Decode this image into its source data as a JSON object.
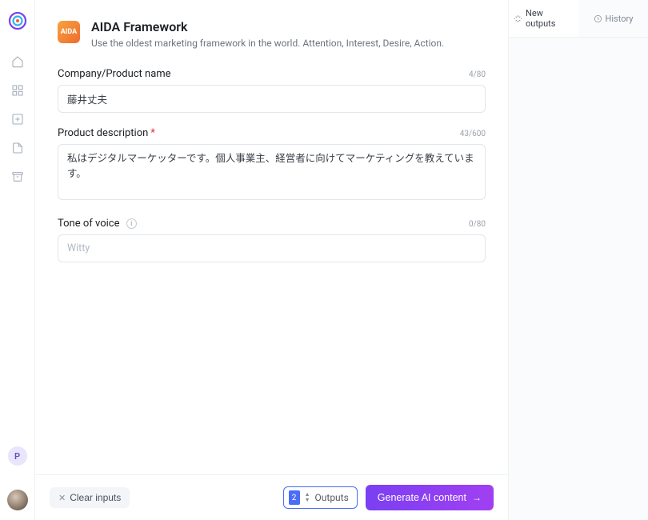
{
  "sidebar": {
    "avatar_initial": "P"
  },
  "header": {
    "icon_text": "AIDA",
    "title": "AIDA Framework",
    "subtitle": "Use the oldest marketing framework in the world. Attention, Interest, Desire, Action."
  },
  "fields": {
    "company": {
      "label": "Company/Product name",
      "value": "藤井丈夫",
      "count": "4/80"
    },
    "description": {
      "label": "Product description",
      "value": "私はデジタルマーケッターです。個人事業主、経営者に向けてマーケティングを教えています。",
      "count": "43/600"
    },
    "tone": {
      "label": "Tone of voice",
      "placeholder": "Witty",
      "value": "",
      "count": "0/80"
    }
  },
  "footer": {
    "clear_label": "Clear inputs",
    "outputs_value": "2",
    "outputs_label": "Outputs",
    "generate_label": "Generate AI content"
  },
  "tabs": {
    "new_outputs": "New outputs",
    "history": "History"
  }
}
